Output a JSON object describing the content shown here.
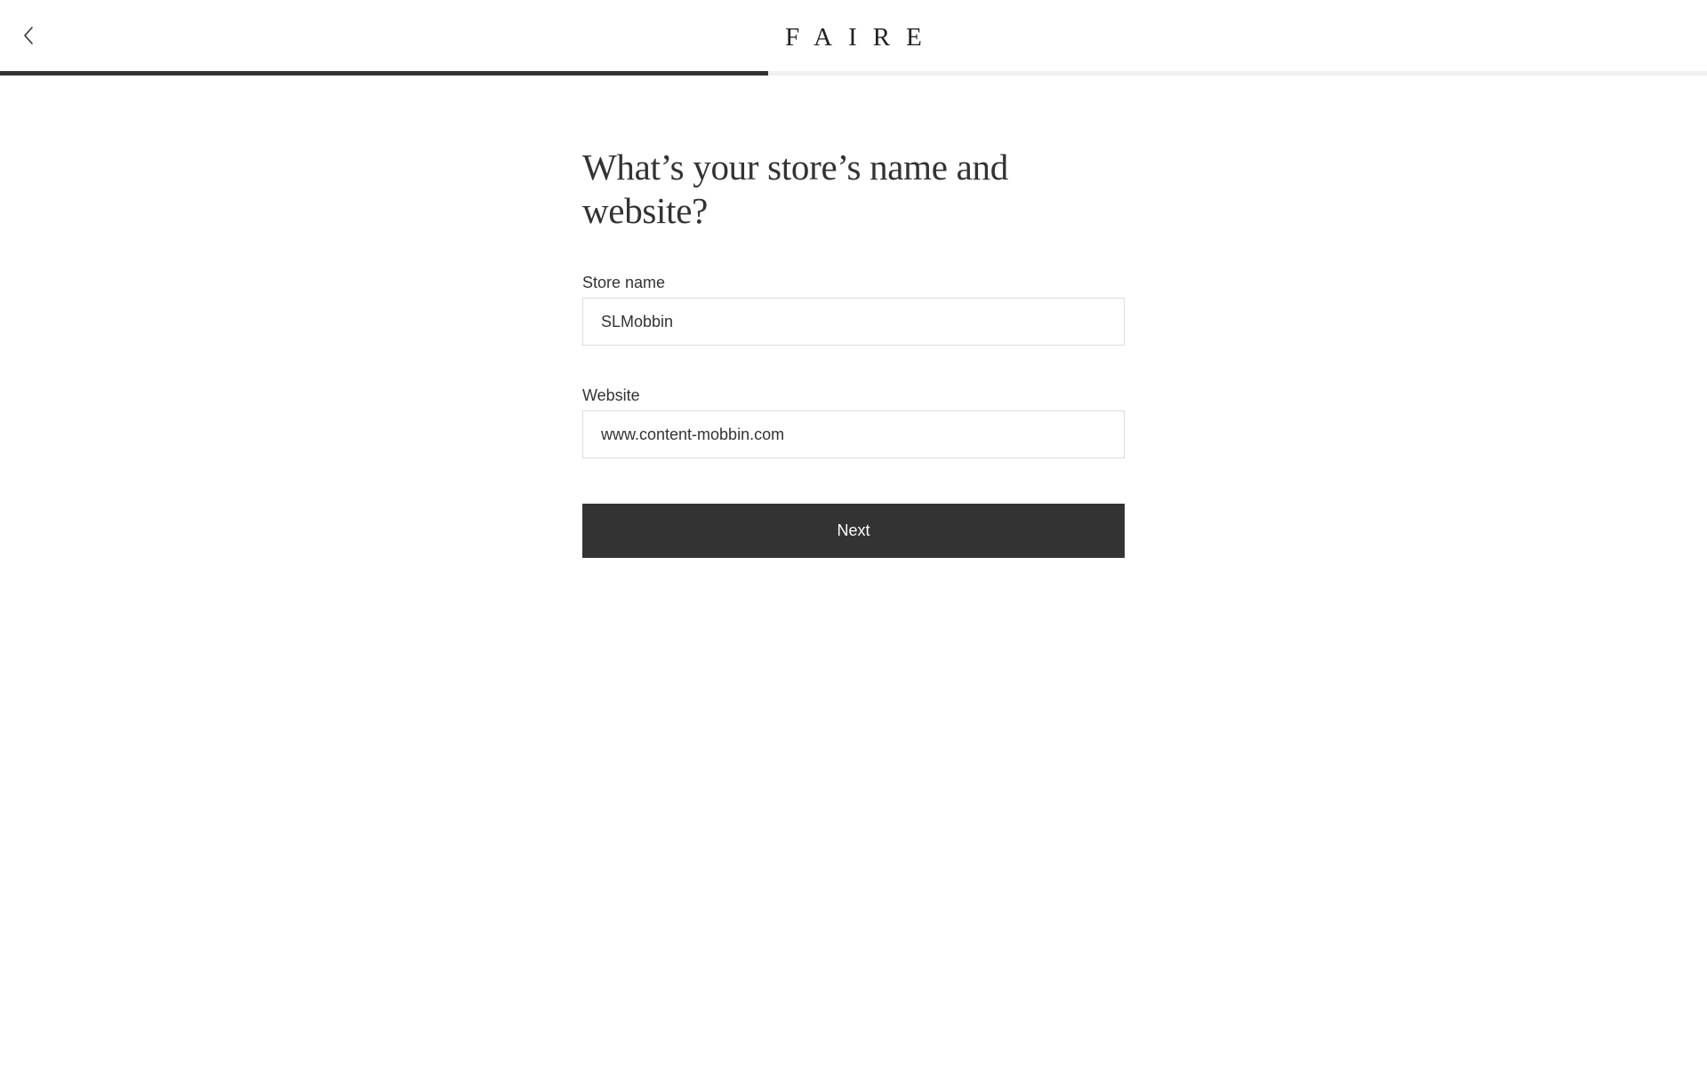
{
  "header": {
    "logo_text": "FAIRE",
    "back_icon": "chevron-left-icon"
  },
  "progress": {
    "fraction": 0.45,
    "fill_color": "#333333",
    "track_color": "#f1f1f1"
  },
  "form": {
    "title": "What’s your store’s name and website?",
    "store_name": {
      "label": "Store name",
      "value": "SLMobbin"
    },
    "website": {
      "label": "Website",
      "value": "www.content-mobbin.com"
    },
    "next_label": "Next"
  },
  "colors": {
    "primary": "#333333",
    "background": "#ffffff",
    "input_border": "#dcdcdc"
  }
}
